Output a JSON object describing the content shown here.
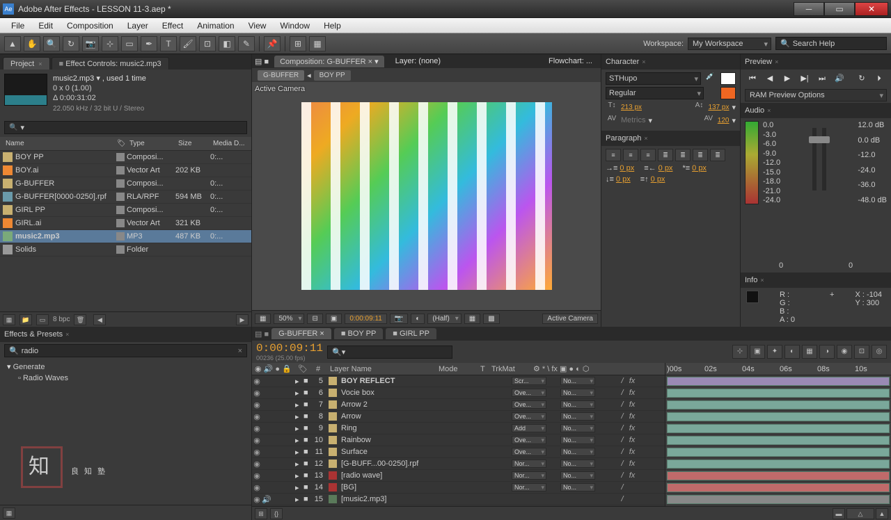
{
  "title": "Adobe After Effects - LESSON 11-3.aep *",
  "menus": [
    "File",
    "Edit",
    "Composition",
    "Layer",
    "Effect",
    "Animation",
    "View",
    "Window",
    "Help"
  ],
  "workspace": {
    "label": "Workspace:",
    "value": "My Workspace"
  },
  "searchHelp": "Search Help",
  "project": {
    "tab": "Project",
    "tab2": "Effect Controls: music2.mp3",
    "sel_name": "music2.mp3 ▾ , used 1 time",
    "sel_dim": "0 x 0 (1.00)",
    "sel_dur": "Δ 0:00:31:02",
    "sel_meta": "22.050 kHz / 32 bit U / Stereo",
    "cols": {
      "name": "Name",
      "type": "Type",
      "size": "Size",
      "md": "Media D..."
    },
    "rows": [
      {
        "name": "BOY PP",
        "type": "Composi...",
        "size": "",
        "md": "0:..."
      },
      {
        "name": "BOY.ai",
        "type": "Vector Art",
        "size": "202 KB",
        "md": ""
      },
      {
        "name": "G-BUFFER",
        "type": "Composi...",
        "size": "",
        "md": "0:..."
      },
      {
        "name": "G-BUFFER[0000-0250].rpf",
        "type": "RLA/RPF",
        "size": "594 MB",
        "md": "0:..."
      },
      {
        "name": "GIRL PP",
        "type": "Composi...",
        "size": "",
        "md": "0:..."
      },
      {
        "name": "GIRL.ai",
        "type": "Vector Art",
        "size": "321 KB",
        "md": ""
      },
      {
        "name": "music2.mp3",
        "type": "MP3",
        "size": "487 KB",
        "md": "0:..."
      },
      {
        "name": "Solids",
        "type": "Folder",
        "size": "",
        "md": ""
      }
    ],
    "bpc": "8 bpc"
  },
  "comp": {
    "tablabel": "Composition: G-BUFFER",
    "layer_none": "Layer: (none)",
    "flowchart": "Flowchart: ...",
    "crumbs": [
      "G-BUFFER",
      "BOY PP"
    ],
    "active_cam": "Active Camera",
    "zoom": "50%",
    "time": "0:00:09:11",
    "res": "(Half)",
    "footer_cam": "Active Camera"
  },
  "character": {
    "title": "Character",
    "font": "STHupo",
    "style": "Regular",
    "size": "213 px",
    "leading": "137 px",
    "kerning": "Metrics",
    "tracking": "120"
  },
  "paragraph": {
    "title": "Paragraph",
    "indent": "0 px"
  },
  "preview": {
    "title": "Preview",
    "ram": "RAM Preview Options"
  },
  "audio": {
    "title": "Audio",
    "left_db": [
      "0.0",
      "-3.0",
      "-6.0",
      "-9.0",
      "-12.0",
      "-15.0",
      "-18.0",
      "-21.0",
      "-24.0"
    ],
    "right_db": [
      "12.0 dB",
      "0.0 dB",
      "-12.0",
      "-24.0",
      "-36.0",
      "-48.0 dB"
    ],
    "bot": [
      "0",
      "0"
    ]
  },
  "info": {
    "title": "Info",
    "r": "R :",
    "g": "G :",
    "b": "B :",
    "a": "A : 0",
    "x": "X : -104",
    "y": "Y : 300"
  },
  "effects": {
    "title": "Effects & Presets",
    "search": "radio",
    "group": "Generate",
    "item": "Radio Waves"
  },
  "timeline": {
    "tabs": [
      "G-BUFFER",
      "BOY PP",
      "GIRL PP"
    ],
    "tc": "0:00:09:11",
    "tc_sub": "00236 (25.00 fps)",
    "cols": {
      "num": "#",
      "layer": "Layer Name",
      "mode": "Mode",
      "trkmat": "TrkMat"
    },
    "ruler": [
      ")00s",
      "02s",
      "04s",
      "06s",
      "08s",
      "10s"
    ],
    "layers": [
      {
        "n": "5",
        "c": "#c8b070",
        "name": "BOY REFLECT",
        "mode": "Scr...",
        "trk": "No...",
        "bold": true
      },
      {
        "n": "6",
        "c": "#c8b070",
        "name": "Vocie box",
        "mode": "Ove...",
        "trk": "No..."
      },
      {
        "n": "7",
        "c": "#c8b070",
        "name": "Arrow 2",
        "mode": "Ove...",
        "trk": "No..."
      },
      {
        "n": "8",
        "c": "#c8b070",
        "name": "Arrow",
        "mode": "Ove...",
        "trk": "No..."
      },
      {
        "n": "9",
        "c": "#c8b070",
        "name": "Ring",
        "mode": "Add",
        "trk": "No..."
      },
      {
        "n": "10",
        "c": "#c8b070",
        "name": "Rainbow",
        "mode": "Ove...",
        "trk": "No..."
      },
      {
        "n": "11",
        "c": "#c8b070",
        "name": "Surface",
        "mode": "Ove...",
        "trk": "No..."
      },
      {
        "n": "12",
        "c": "#c8b070",
        "name": "[G-BUFF...00-0250].rpf",
        "mode": "Nor...",
        "trk": "No..."
      },
      {
        "n": "13",
        "c": "#aa3333",
        "name": "[radio wave]",
        "mode": "Nor...",
        "trk": "No..."
      },
      {
        "n": "14",
        "c": "#aa3333",
        "name": "[BG]",
        "mode": "Nor...",
        "trk": "No..."
      },
      {
        "n": "15",
        "c": "#5a7a5a",
        "name": "[music2.mp3]",
        "mode": "",
        "trk": ""
      }
    ]
  },
  "watermark": "良知塾"
}
